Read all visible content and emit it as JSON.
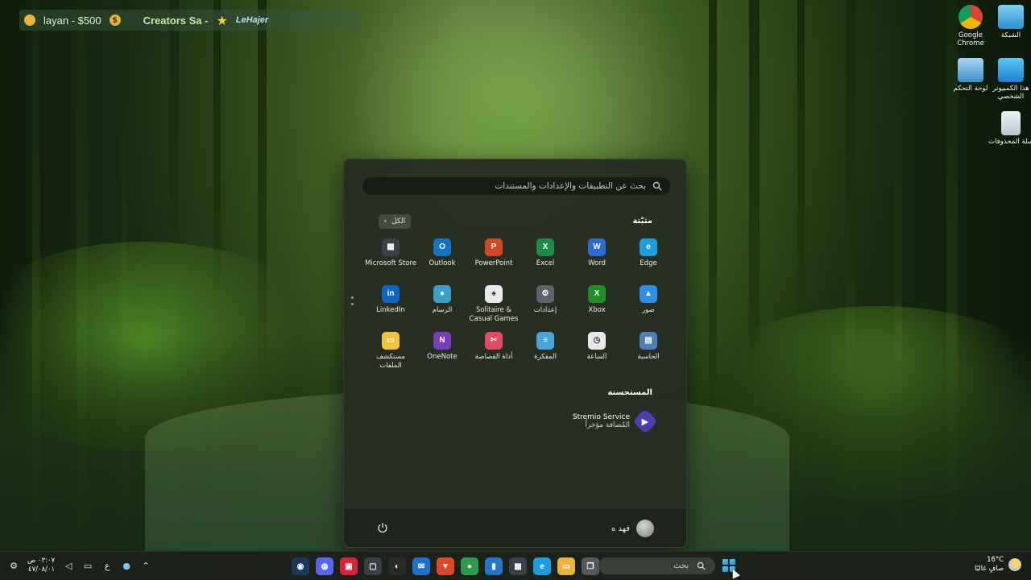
{
  "banner": {
    "coin_symbol": "$",
    "left_text": "layan - $500",
    "center_text": "Creators Sa -",
    "right_text": "LeHajer"
  },
  "desktop_icons": [
    {
      "name": "chrome",
      "label": "Google Chrome"
    },
    {
      "name": "network",
      "label": "الشبكة"
    },
    {
      "name": "control-panel",
      "label": "لوحة التحكم"
    },
    {
      "name": "this-pc",
      "label": "هذا الكمبيوتر الشخصي"
    },
    {
      "name": "recycle-bin",
      "label": "سلة المحذوفات"
    }
  ],
  "start_menu": {
    "search_placeholder": "بحث عن التطبيقات والإعدادات والمستندات",
    "pinned_label": "مثبّتة",
    "all_label": "الكل",
    "recommended_label": "المستحسنة",
    "pinned_apps": [
      {
        "label": "Edge",
        "icon": "edge-icon",
        "glyph": "e",
        "color": "#1f9be0"
      },
      {
        "label": "Word",
        "icon": "word-icon",
        "glyph": "W",
        "color": "#2b6bd1"
      },
      {
        "label": "Excel",
        "icon": "excel-icon",
        "glyph": "X",
        "color": "#1e8a4a"
      },
      {
        "label": "PowerPoint",
        "icon": "powerpoint-icon",
        "glyph": "P",
        "color": "#d24726"
      },
      {
        "label": "Outlook",
        "icon": "outlook-icon",
        "glyph": "O",
        "color": "#1273c4"
      },
      {
        "label": "Microsoft Store",
        "icon": "store-icon",
        "glyph": "▦",
        "color": "#3a3f48"
      },
      {
        "label": "صور",
        "icon": "photos-icon",
        "glyph": "▲",
        "color": "#2f8ee6"
      },
      {
        "label": "Xbox",
        "icon": "xbox-icon",
        "glyph": "X",
        "color": "#1f8f2a"
      },
      {
        "label": "إعدادات",
        "icon": "settings-icon",
        "glyph": "⚙",
        "color": "#5b636b"
      },
      {
        "label": "Solitaire & Casual Games",
        "icon": "solitaire-icon",
        "glyph": "♠",
        "color": "#e9e9e9"
      },
      {
        "label": "الرسام",
        "icon": "paint-icon",
        "glyph": "●",
        "color": "#3aa0c8"
      },
      {
        "label": "LinkedIn",
        "icon": "linkedin-icon",
        "glyph": "in",
        "color": "#0a66c2"
      },
      {
        "label": "الحاسبة",
        "icon": "calculator-icon",
        "glyph": "▤",
        "color": "#4c7fb8"
      },
      {
        "label": "الساعة",
        "icon": "clock-icon",
        "glyph": "◷",
        "color": "#e8e8e8"
      },
      {
        "label": "المفكرة",
        "icon": "notepad-icon",
        "glyph": "≡",
        "color": "#49a3d8"
      },
      {
        "label": "أداة القصاصة",
        "icon": "snipping-tool-icon",
        "glyph": "✂",
        "color": "#e34a60"
      },
      {
        "label": "OneNote",
        "icon": "onenote-icon",
        "glyph": "N",
        "color": "#7a3db8"
      },
      {
        "label": "مستكشف الملفات",
        "icon": "file-explorer-icon",
        "glyph": "▭",
        "color": "#f3c33b"
      }
    ],
    "recommended": {
      "title": "Stremio Service",
      "subtitle": "المُضافة مؤخراً"
    },
    "user_name": "فهد ه"
  },
  "taskbar": {
    "search_text": "بحث",
    "clock_time": "٠٣:٠٧ ص",
    "clock_date": "٤٧/٠٨/٠١",
    "lang": "ع",
    "weather_temp": "16°C",
    "weather_desc": "صافٍ غالبًا",
    "apps": [
      {
        "name": "steam-icon",
        "glyph": "◉",
        "color": "#1b3a5a"
      },
      {
        "name": "discord-icon",
        "glyph": "◍",
        "color": "#5865f2"
      },
      {
        "name": "app-red-icon",
        "glyph": "▣",
        "color": "#d8233a"
      },
      {
        "name": "xbox-taskbar-icon",
        "glyph": "▢",
        "color": "#3a3f44"
      },
      {
        "name": "github-desktop-icon",
        "glyph": "◐",
        "color": "#2a2a2a"
      },
      {
        "name": "mail-icon",
        "glyph": "✉",
        "color": "#1a73c8"
      },
      {
        "name": "brave-icon",
        "glyph": "▼",
        "color": "#e0482a"
      },
      {
        "name": "chrome-taskbar-icon",
        "glyph": "●",
        "color": "#2f9b4e"
      },
      {
        "name": "vscode-icon",
        "glyph": "▮",
        "color": "#2376c8"
      },
      {
        "name": "store-taskbar-icon",
        "glyph": "▦",
        "color": "#3a3f48"
      },
      {
        "name": "edge-taskbar-icon",
        "glyph": "e",
        "color": "#1f9be0"
      },
      {
        "name": "file-explorer-taskbar-icon",
        "glyph": "▭",
        "color": "#e8b43a"
      },
      {
        "name": "task-view-icon",
        "glyph": "❐",
        "color": "#55595f"
      }
    ]
  }
}
